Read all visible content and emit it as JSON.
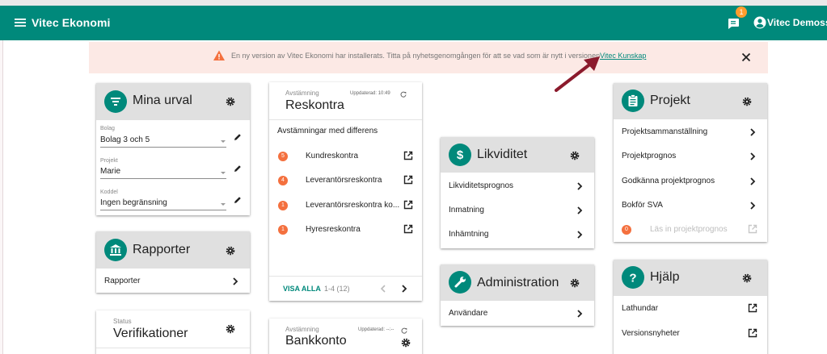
{
  "app": {
    "title": "Vitec Ekonomi",
    "chat_badge_count": "1",
    "user_name": "Vitec Demosson",
    "accent_color": "#00897b"
  },
  "banner": {
    "text": "En ny version av Vitec Ekonomi har installerats. Titta på nyhetsgenomgången för att se vad som är nytt i versionen",
    "link": "Vitec Kunskap",
    "icon": "warning-icon"
  },
  "mina_urval": {
    "title": "Mina urval",
    "fields": [
      {
        "label": "Bolag",
        "value": "Bolag 3 och 5"
      },
      {
        "label": "Projekt",
        "value": "Marie"
      },
      {
        "label": "Koddel",
        "value": "Ingen begränsning"
      }
    ]
  },
  "rapporter": {
    "title": "Rapporter",
    "items": [
      "Rapporter"
    ]
  },
  "verifikationer": {
    "subtitle": "Status",
    "title": "Verifikationer"
  },
  "reskontra": {
    "subtitle": "Avstämning",
    "title": "Reskontra",
    "updated": "Uppdaterad: 10:49",
    "section": "Avstämningar med differens",
    "items": [
      {
        "count": "5",
        "label": "Kundreskontra"
      },
      {
        "count": "4",
        "label": "Leverantörsreskontra"
      },
      {
        "count": "1",
        "label": "Leverantörsreskontra ko..."
      },
      {
        "count": "1",
        "label": "Hyresreskontra"
      }
    ],
    "show_all": "VISA ALLA",
    "pager": "1-4 (12)"
  },
  "bankkonto": {
    "subtitle": "Avstämning",
    "title": "Bankkonto",
    "updated": "Uppdaterad: --:--"
  },
  "likviditet": {
    "title": "Likviditet",
    "items": [
      "Likviditetsprognos",
      "Inmatning",
      "Inhämtning"
    ]
  },
  "administration": {
    "title": "Administration",
    "items": [
      "Användare"
    ]
  },
  "projekt": {
    "title": "Projekt",
    "items": [
      "Projektsammanställning",
      "Projektprognos",
      "Godkänna projektprognos",
      "Bokför SVA"
    ],
    "disabled_item": {
      "count": "0",
      "label": "Läs in projektprognos"
    }
  },
  "hjalp": {
    "title": "Hjälp",
    "items": [
      "Lathundar",
      "Versionsnyheter"
    ]
  }
}
